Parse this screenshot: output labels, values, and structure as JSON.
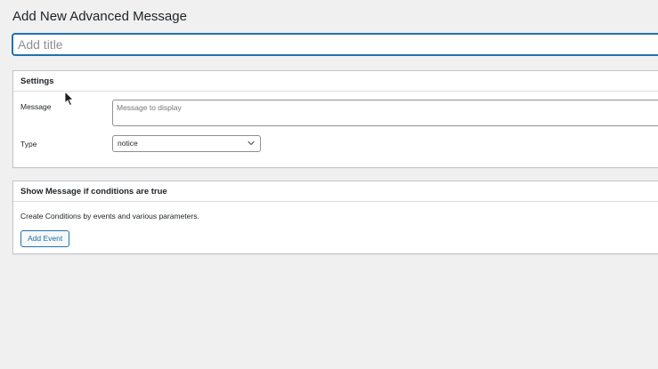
{
  "page": {
    "title": "Add New Advanced Message",
    "title_placeholder": "Add title"
  },
  "settings": {
    "heading": "Settings",
    "message_label": "Message",
    "message_placeholder": "Message to display",
    "type_label": "Type",
    "type_value": "notice"
  },
  "conditions": {
    "heading": "Show Message if conditions are true",
    "description": "Create Conditions by events and various parameters.",
    "add_event_label": "Add Event"
  },
  "colors": {
    "accent": "#2271b1",
    "background": "#f0f0f1",
    "border": "#c3c4c7"
  },
  "icons": {
    "select_chevron": "chevron-down-icon",
    "cursor": "mouse-pointer-icon"
  }
}
